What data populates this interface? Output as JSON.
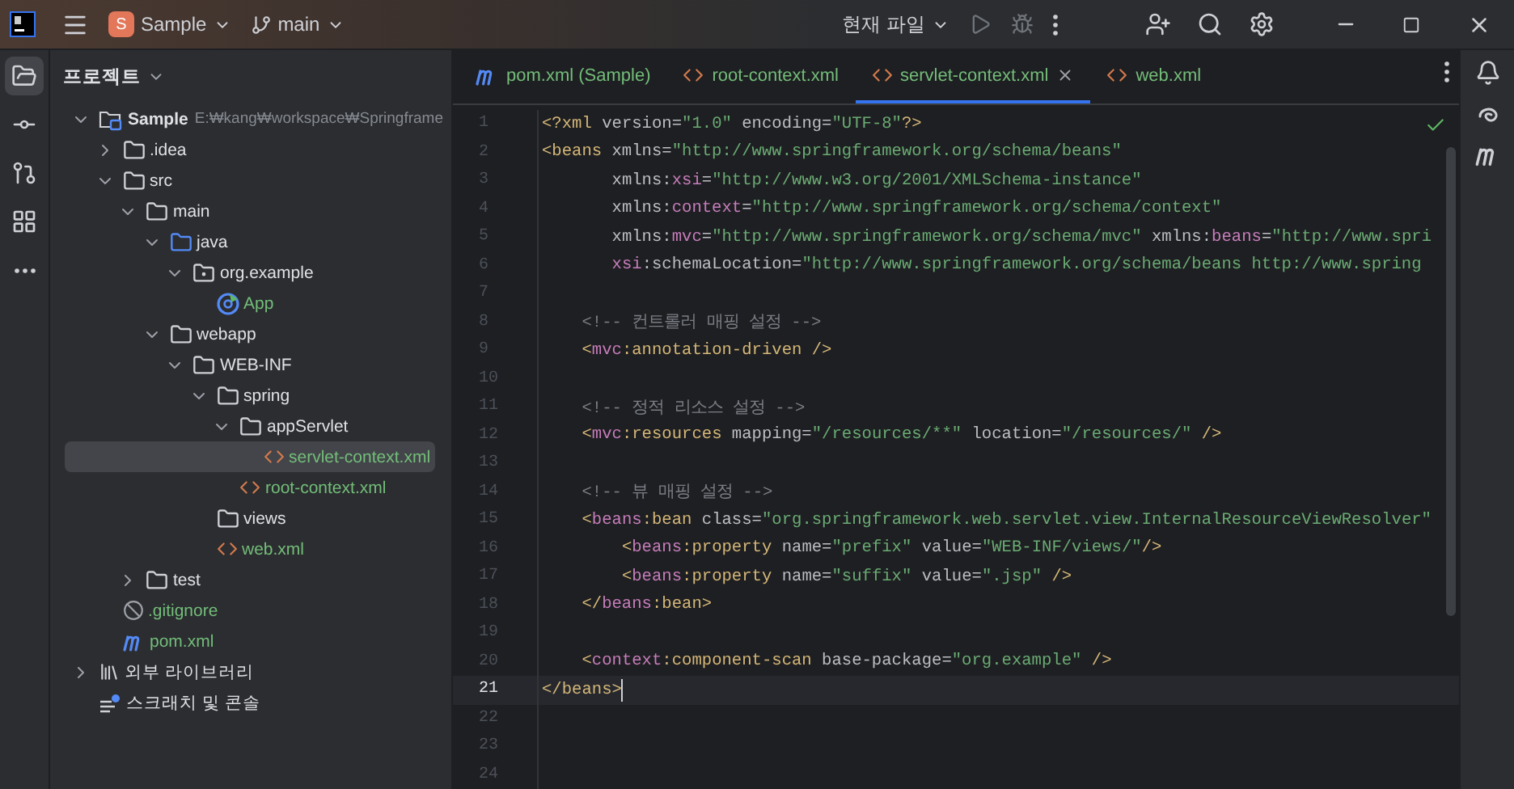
{
  "title_bar": {
    "project_badge": "S",
    "project": "Sample",
    "branch": "main",
    "run_config": "현재 파일"
  },
  "tool_strip": [
    {
      "kind": "project",
      "selected": true
    },
    {
      "kind": "commit",
      "selected": false
    },
    {
      "kind": "pull-requests",
      "selected": false
    },
    {
      "kind": "structure",
      "selected": false
    },
    {
      "kind": "more",
      "selected": false
    }
  ],
  "sidebar": {
    "title": "프로젝트",
    "tree": [
      {
        "label": "Sample",
        "path": "E:₩kang₩workspace₩Springframe",
        "kind": "project",
        "expanded": true,
        "selected": false,
        "added": false,
        "children": [
          {
            "label": ".idea",
            "kind": "folder",
            "expanded": false,
            "selected": false,
            "added": false
          },
          {
            "label": "src",
            "kind": "folder",
            "expanded": true,
            "selected": false,
            "added": false,
            "children": [
              {
                "label": "main",
                "kind": "folder",
                "expanded": true,
                "selected": false,
                "added": false,
                "children": [
                  {
                    "label": "java",
                    "kind": "source-folder",
                    "expanded": true,
                    "selected": false,
                    "added": false,
                    "children": [
                      {
                        "label": "org.example",
                        "kind": "package",
                        "expanded": true,
                        "selected": false,
                        "added": false,
                        "children": [
                          {
                            "label": "App",
                            "kind": "class",
                            "selected": false,
                            "added": true
                          }
                        ]
                      }
                    ]
                  },
                  {
                    "label": "webapp",
                    "kind": "folder",
                    "expanded": true,
                    "selected": false,
                    "added": false,
                    "children": [
                      {
                        "label": "WEB-INF",
                        "kind": "folder",
                        "expanded": true,
                        "selected": false,
                        "added": false,
                        "children": [
                          {
                            "label": "spring",
                            "kind": "folder",
                            "expanded": true,
                            "selected": false,
                            "added": false,
                            "children": [
                              {
                                "label": "appServlet",
                                "kind": "folder",
                                "expanded": true,
                                "selected": false,
                                "added": false,
                                "children": [
                                  {
                                    "label": "servlet-context.xml",
                                    "kind": "xml",
                                    "selected": true,
                                    "added": true
                                  }
                                ]
                              },
                              {
                                "label": "root-context.xml",
                                "kind": "xml",
                                "selected": false,
                                "added": true
                              }
                            ]
                          },
                          {
                            "label": "views",
                            "kind": "folder",
                            "selected": false,
                            "added": false
                          },
                          {
                            "label": "web.xml",
                            "kind": "xml",
                            "selected": false,
                            "added": true
                          }
                        ]
                      }
                    ]
                  }
                ]
              },
              {
                "label": "test",
                "kind": "folder",
                "expanded": false,
                "selected": false,
                "added": false
              }
            ]
          },
          {
            "label": ".gitignore",
            "kind": "ignore",
            "selected": false,
            "added": true
          },
          {
            "label": "pom.xml",
            "kind": "maven",
            "selected": false,
            "added": true
          }
        ]
      },
      {
        "label": "외부 라이브러리",
        "kind": "library",
        "expanded": false,
        "selected": false,
        "added": false
      },
      {
        "label": "스크래치 및 콘솔",
        "kind": "scratch",
        "selected": false,
        "added": false
      }
    ]
  },
  "tabs": [
    {
      "label": "pom.xml (Sample)",
      "kind": "maven",
      "selected": false,
      "added": true
    },
    {
      "label": "root-context.xml",
      "kind": "xml",
      "selected": false,
      "added": true
    },
    {
      "label": "servlet-context.xml",
      "kind": "xml",
      "selected": true,
      "added": true
    },
    {
      "label": "web.xml",
      "kind": "xml",
      "selected": false,
      "added": true
    }
  ],
  "editor": {
    "lines": [
      {
        "n": "1",
        "current": false,
        "tokens": [
          {
            "kind": "tag",
            "t": "<?xml"
          },
          {
            "kind": "attr",
            "t": " version="
          },
          {
            "kind": "str",
            "t": "\"1.0\""
          },
          {
            "kind": "attr",
            "t": " encoding="
          },
          {
            "kind": "str",
            "t": "\"UTF-8\""
          },
          {
            "kind": "tag",
            "t": "?>"
          }
        ]
      },
      {
        "n": "2",
        "current": false,
        "tokens": [
          {
            "kind": "tag",
            "t": "<beans"
          },
          {
            "kind": "attr",
            "t": " xmlns="
          },
          {
            "kind": "str",
            "t": "\"http://www.springframework.org/schema/beans\""
          }
        ]
      },
      {
        "n": "3",
        "current": false,
        "tokens": [
          {
            "kind": "attr",
            "t": "       xmlns:"
          },
          {
            "kind": "ns",
            "t": "xsi"
          },
          {
            "kind": "attr",
            "t": "="
          },
          {
            "kind": "str",
            "t": "\"http://www.w3.org/2001/XMLSchema-instance\""
          }
        ]
      },
      {
        "n": "4",
        "current": false,
        "tokens": [
          {
            "kind": "attr",
            "t": "       xmlns:"
          },
          {
            "kind": "ns",
            "t": "context"
          },
          {
            "kind": "attr",
            "t": "="
          },
          {
            "kind": "str",
            "t": "\"http://www.springframework.org/schema/context\""
          }
        ]
      },
      {
        "n": "5",
        "current": false,
        "tokens": [
          {
            "kind": "attr",
            "t": "       xmlns:"
          },
          {
            "kind": "ns",
            "t": "mvc"
          },
          {
            "kind": "attr",
            "t": "="
          },
          {
            "kind": "str",
            "t": "\"http://www.springframework.org/schema/mvc\""
          },
          {
            "kind": "attr",
            "t": " xmlns:"
          },
          {
            "kind": "ns",
            "t": "beans"
          },
          {
            "kind": "attr",
            "t": "="
          },
          {
            "kind": "str",
            "t": "\"http://www.spri"
          }
        ]
      },
      {
        "n": "6",
        "current": false,
        "tokens": [
          {
            "kind": "ns",
            "t": "       xsi"
          },
          {
            "kind": "attr",
            "t": ":schemaLocation="
          },
          {
            "kind": "str",
            "t": "\"http://www.springframework.org/schema/beans http://www.spring"
          }
        ]
      },
      {
        "n": "7",
        "current": false
      },
      {
        "n": "8",
        "current": false,
        "tokens": [
          {
            "kind": "comment",
            "t": "    <!-- 컨트롤러 매핑 설정 -->"
          }
        ]
      },
      {
        "n": "9",
        "current": false,
        "tokens": [
          {
            "kind": "tag",
            "t": "    <"
          },
          {
            "kind": "ns",
            "t": "mvc"
          },
          {
            "kind": "tag",
            "t": ":annotation-driven />"
          }
        ]
      },
      {
        "n": "10",
        "current": false
      },
      {
        "n": "11",
        "current": false,
        "tokens": [
          {
            "kind": "comment",
            "t": "    <!-- 정적 리소스 설정 -->"
          }
        ]
      },
      {
        "n": "12",
        "current": false,
        "tokens": [
          {
            "kind": "tag",
            "t": "    <"
          },
          {
            "kind": "ns",
            "t": "mvc"
          },
          {
            "kind": "tag",
            "t": ":resources"
          },
          {
            "kind": "attr",
            "t": " mapping="
          },
          {
            "kind": "str",
            "t": "\"/resources/**\""
          },
          {
            "kind": "attr",
            "t": " location="
          },
          {
            "kind": "str",
            "t": "\"/resources/\""
          },
          {
            "kind": "tag",
            "t": " />"
          }
        ]
      },
      {
        "n": "13",
        "current": false
      },
      {
        "n": "14",
        "current": false,
        "tokens": [
          {
            "kind": "comment",
            "t": "    <!-- 뷰 매핑 설정 -->"
          }
        ]
      },
      {
        "n": "15",
        "current": false,
        "tokens": [
          {
            "kind": "tag",
            "t": "    <"
          },
          {
            "kind": "ns",
            "t": "beans"
          },
          {
            "kind": "tag",
            "t": ":bean"
          },
          {
            "kind": "attr",
            "t": " class="
          },
          {
            "kind": "str",
            "t": "\"org.springframework.web.servlet.view.InternalResourceViewResolver\""
          }
        ]
      },
      {
        "n": "16",
        "current": false,
        "tokens": [
          {
            "kind": "tag",
            "t": "        <"
          },
          {
            "kind": "ns",
            "t": "beans"
          },
          {
            "kind": "tag",
            "t": ":property"
          },
          {
            "kind": "attr",
            "t": " name="
          },
          {
            "kind": "str",
            "t": "\"prefix\""
          },
          {
            "kind": "attr",
            "t": " value="
          },
          {
            "kind": "str",
            "t": "\"WEB-INF/views/\""
          },
          {
            "kind": "tag",
            "t": "/>"
          }
        ]
      },
      {
        "n": "17",
        "current": false,
        "tokens": [
          {
            "kind": "tag",
            "t": "        <"
          },
          {
            "kind": "ns",
            "t": "beans"
          },
          {
            "kind": "tag",
            "t": ":property"
          },
          {
            "kind": "attr",
            "t": " name="
          },
          {
            "kind": "str",
            "t": "\"suffix\""
          },
          {
            "kind": "attr",
            "t": " value="
          },
          {
            "kind": "str",
            "t": "\".jsp\""
          },
          {
            "kind": "tag",
            "t": " />"
          }
        ]
      },
      {
        "n": "18",
        "current": false,
        "tokens": [
          {
            "kind": "tag",
            "t": "    </"
          },
          {
            "kind": "ns",
            "t": "beans"
          },
          {
            "kind": "tag",
            "t": ":bean>"
          }
        ]
      },
      {
        "n": "19",
        "current": false
      },
      {
        "n": "20",
        "current": false,
        "tokens": [
          {
            "kind": "tag",
            "t": "    <"
          },
          {
            "kind": "ns",
            "t": "context"
          },
          {
            "kind": "tag",
            "t": ":component-scan"
          },
          {
            "kind": "attr",
            "t": " base-package="
          },
          {
            "kind": "str",
            "t": "\"org.example\""
          },
          {
            "kind": "tag",
            "t": " />"
          }
        ]
      },
      {
        "n": "21",
        "current": true,
        "tokens": [
          {
            "kind": "tag",
            "t": "</beans>"
          }
        ]
      },
      {
        "n": "22",
        "current": false
      },
      {
        "n": "23",
        "current": false
      },
      {
        "n": "24",
        "current": false
      }
    ]
  },
  "right_strip": [
    {
      "kind": "notifications"
    },
    {
      "kind": "ai"
    },
    {
      "kind": "maven"
    }
  ]
}
